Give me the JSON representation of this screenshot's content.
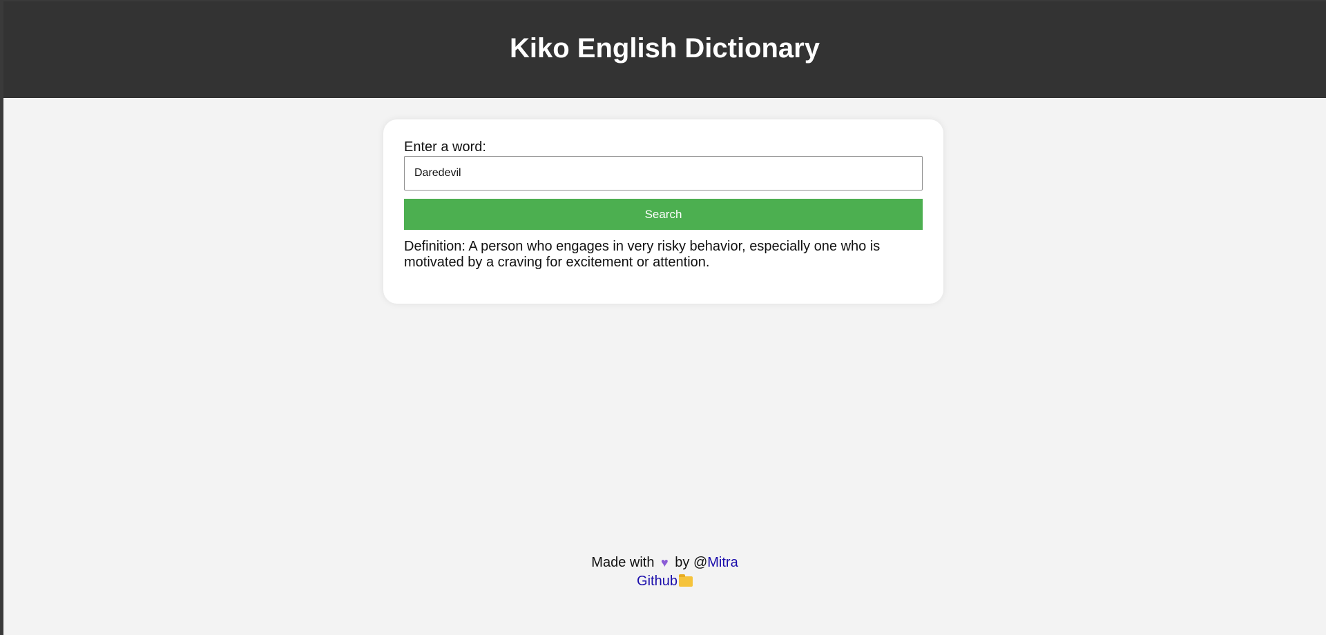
{
  "header": {
    "title": "Kiko English Dictionary"
  },
  "search": {
    "label": "Enter a word:",
    "value": "Daredevil",
    "button_label": "Search"
  },
  "result": {
    "definition": "Definition: A person who engages in very risky behavior, especially one who is motivated by a craving for excitement or attention."
  },
  "footer": {
    "made_with_prefix": "Made with",
    "heart_icon": "heart-icon",
    "by_text": "by @",
    "author_link": "Mitra",
    "github_link": "Github",
    "folder_icon": "folder-icon"
  },
  "colors": {
    "header_bg": "#333333",
    "page_bg": "#f3f3f3",
    "button_bg": "#4caf50",
    "link": "#1a0dab",
    "heart": "#8a5cd6"
  }
}
